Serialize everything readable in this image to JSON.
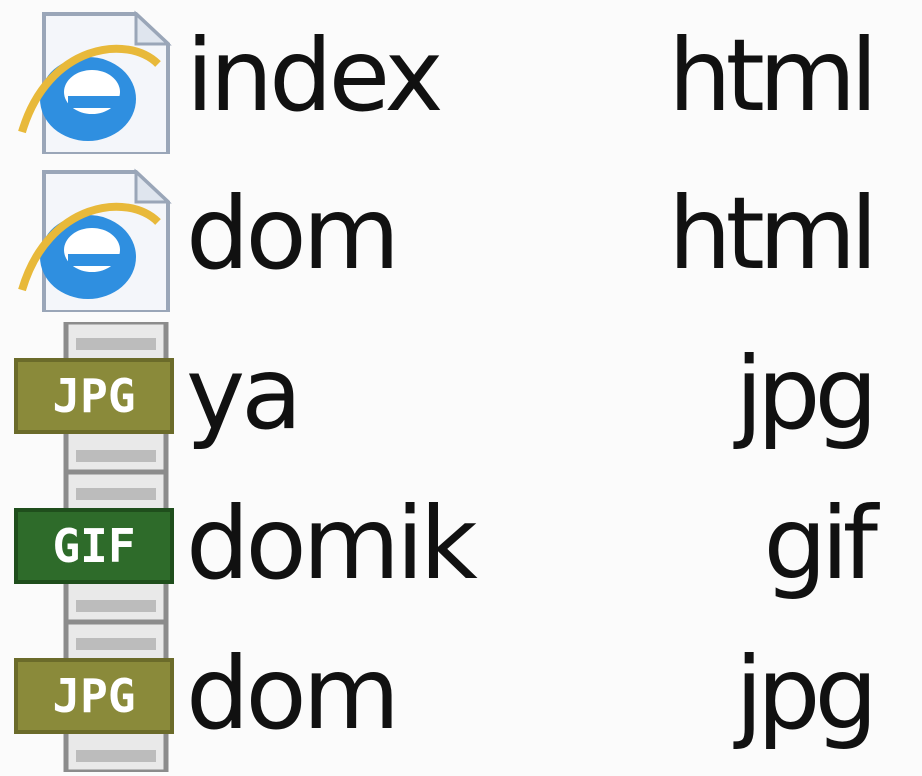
{
  "files": [
    {
      "name": "index",
      "ext": "html",
      "icon": "ie-html-icon"
    },
    {
      "name": "dom",
      "ext": "html",
      "icon": "ie-html-icon"
    },
    {
      "name": "ya",
      "ext": "jpg",
      "icon": "jpg-icon",
      "icon_label": "JPG",
      "icon_color": "#8a8a3a"
    },
    {
      "name": "domik",
      "ext": "gif",
      "icon": "gif-icon",
      "icon_label": "GIF",
      "icon_color": "#2e6b2a"
    },
    {
      "name": "dom",
      "ext": "jpg",
      "icon": "jpg-icon",
      "icon_label": "JPG",
      "icon_color": "#8a8a3a"
    }
  ]
}
